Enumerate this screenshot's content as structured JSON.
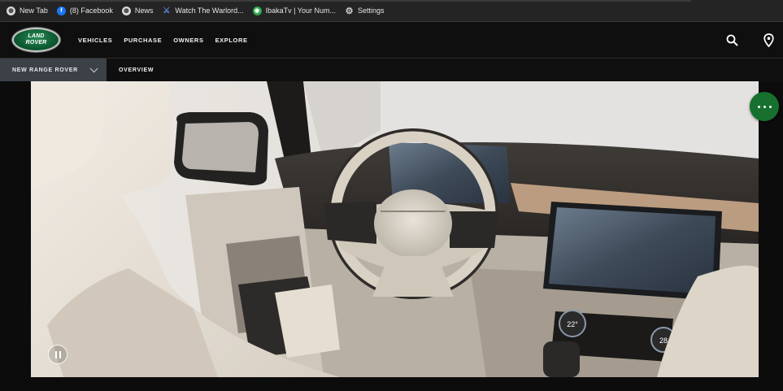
{
  "bookmarks": [
    {
      "label": "New Tab",
      "icon": "globe-icon"
    },
    {
      "label": "(8) Facebook",
      "icon": "facebook-icon"
    },
    {
      "label": "News",
      "icon": "globe-icon"
    },
    {
      "label": "Watch The Warlord...",
      "icon": "warlord-icon"
    },
    {
      "label": "IbakaTv | Your Num...",
      "icon": "ibakatv-icon"
    },
    {
      "label": "Settings",
      "icon": "gear-icon"
    }
  ],
  "nav": {
    "logo_line1": "LAND",
    "logo_line2": "ROVER",
    "links": [
      "VEHICLES",
      "PURCHASE",
      "OWNERS",
      "EXPLORE"
    ]
  },
  "subnav": {
    "model": "NEW RANGE ROVER",
    "overview": "OVERVIEW"
  },
  "hero": {
    "climate_left": "22°",
    "climate_right": "28"
  },
  "colors": {
    "brand_green": "#17702e",
    "subnav_active": "#3c4148"
  }
}
